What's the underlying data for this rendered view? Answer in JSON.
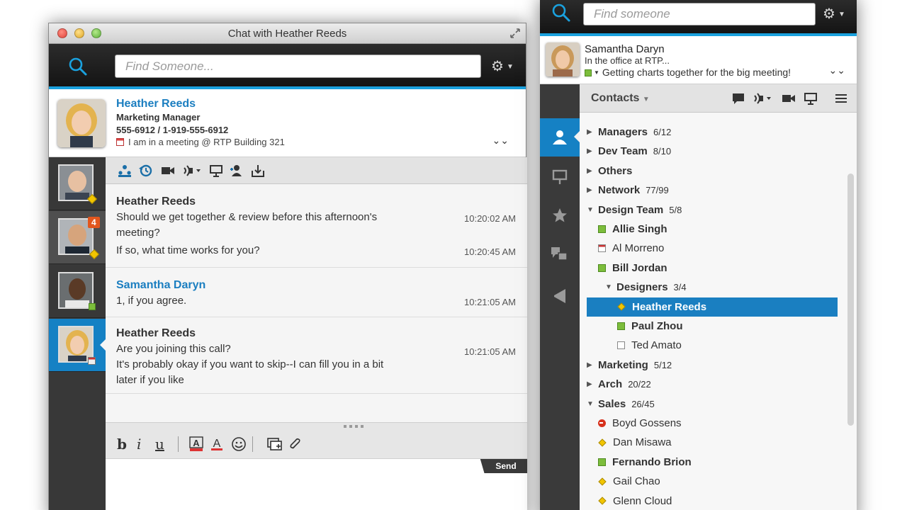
{
  "chat_window": {
    "title": "Chat with Heather Reeds",
    "search_placeholder": "Find Someone...",
    "profile": {
      "name": "Heather Reeds",
      "title": "Marketing Manager",
      "phone": "555-6912 / 1-919-555-6912",
      "status": "I am in a meeting @ RTP Building 321"
    },
    "rail": [
      {
        "name": "contact-1",
        "status": "away"
      },
      {
        "name": "contact-2",
        "status": "away",
        "badge": "4"
      },
      {
        "name": "contact-3",
        "status": "available"
      },
      {
        "name": "heather-reeds",
        "status": "meeting"
      }
    ],
    "messages": [
      {
        "sender": "Heather Reeds",
        "lines": [
          {
            "text": "Should we get together & review before this afternoon's meeting?",
            "time": "10:20:02 AM"
          },
          {
            "text": "If so, what time works for you?",
            "time": "10:20:45 AM"
          }
        ]
      },
      {
        "sender": "Samantha Daryn",
        "lines": [
          {
            "text": "1, if you agree.",
            "time": "10:21:05 AM"
          }
        ]
      },
      {
        "sender": "Heather Reeds",
        "lines": [
          {
            "text": "Are you joining this call?",
            "time": "10:21:05 AM"
          },
          {
            "text": "It's probably okay if you want to skip--I can fill you in a bit later if you like",
            "time": ""
          }
        ]
      }
    ],
    "format": {
      "bold": "b",
      "italic": "i",
      "underline": "u"
    },
    "send_label": "Send"
  },
  "contacts_window": {
    "search_placeholder": "Find someone",
    "me": {
      "name": "Samantha Daryn",
      "location": "In the office at RTP...",
      "status": "Getting charts together for the big meeting!"
    },
    "contacts_label": "Contacts",
    "tree": [
      {
        "label": "Managers",
        "count": "6/12",
        "type": "group",
        "expanded": false,
        "indent": 0
      },
      {
        "label": "Dev Team",
        "count": "8/10",
        "type": "group",
        "expanded": false,
        "indent": 0
      },
      {
        "label": "Others",
        "count": "",
        "type": "group",
        "expanded": false,
        "indent": 0
      },
      {
        "label": "Network",
        "count": "77/99",
        "type": "group",
        "expanded": false,
        "indent": 0
      },
      {
        "label": "Design Team",
        "count": "5/8",
        "type": "group",
        "expanded": true,
        "indent": 0
      },
      {
        "label": "Allie Singh",
        "status": "available",
        "type": "contact",
        "indent": 1
      },
      {
        "label": "Al Morreno",
        "status": "meeting",
        "type": "contact",
        "indent": 1
      },
      {
        "label": "Bill Jordan",
        "status": "available",
        "type": "contact",
        "indent": 1
      },
      {
        "label": "Designers",
        "count": "3/4",
        "type": "group",
        "expanded": true,
        "indent": 1
      },
      {
        "label": "Heather Reeds",
        "status": "away",
        "type": "contact",
        "indent": 2,
        "selected": true
      },
      {
        "label": "Paul Zhou",
        "status": "available",
        "type": "contact",
        "indent": 2
      },
      {
        "label": "Ted Amato",
        "status": "phone",
        "type": "contact",
        "indent": 2
      },
      {
        "label": "Marketing",
        "count": "5/12",
        "type": "group",
        "expanded": false,
        "indent": 0
      },
      {
        "label": "Arch",
        "count": "20/22",
        "type": "group",
        "expanded": false,
        "indent": 0
      },
      {
        "label": "Sales",
        "count": "26/45",
        "type": "group",
        "expanded": true,
        "indent": 0
      },
      {
        "label": "Boyd Gossens",
        "status": "dnd",
        "type": "contact",
        "indent": 1
      },
      {
        "label": "Dan Misawa",
        "status": "away",
        "type": "contact",
        "indent": 1
      },
      {
        "label": "Fernando Brion",
        "status": "available",
        "type": "contact",
        "indent": 1
      },
      {
        "label": "Gail Chao",
        "status": "away",
        "type": "contact",
        "indent": 1
      },
      {
        "label": "Glenn Cloud",
        "status": "away",
        "type": "contact",
        "indent": 1
      }
    ]
  },
  "colors": {
    "accent": "#1aa1de",
    "selection": "#1a7fc1",
    "name_blue": "#1b7ec0",
    "available": "#7cbd3b",
    "away": "#f2c500",
    "dnd": "#d7311c"
  }
}
